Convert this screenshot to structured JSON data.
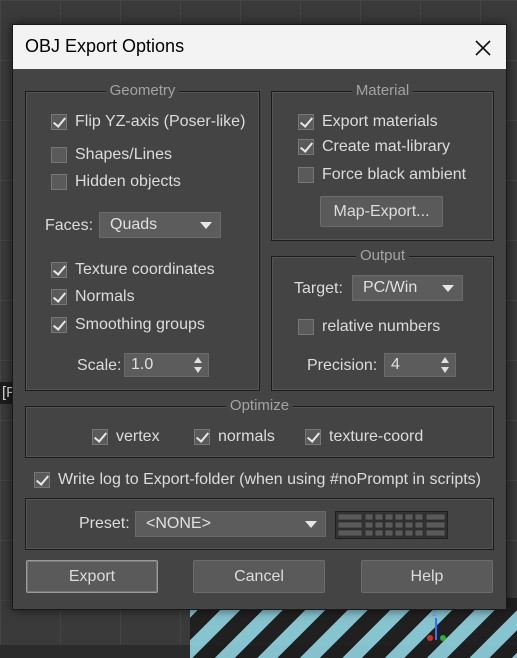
{
  "dialog": {
    "title": "OBJ Export Options"
  },
  "viewport": {
    "left_label": "[F"
  },
  "geometry": {
    "legend": "Geometry",
    "flip_yz": {
      "label": "Flip YZ-axis (Poser-like)",
      "checked": true
    },
    "shapes_lines": {
      "label": "Shapes/Lines",
      "checked": false
    },
    "hidden_objects": {
      "label": "Hidden objects",
      "checked": false
    },
    "faces_label": "Faces:",
    "faces_value": "Quads",
    "texture_coordinates": {
      "label": "Texture coordinates",
      "checked": true
    },
    "normals": {
      "label": "Normals",
      "checked": true
    },
    "smoothing_groups": {
      "label": "Smoothing groups",
      "checked": true
    },
    "scale_label": "Scale:",
    "scale_value": "1.0"
  },
  "material": {
    "legend": "Material",
    "export_materials": {
      "label": "Export materials",
      "checked": true
    },
    "create_mat_library": {
      "label": "Create mat-library",
      "checked": true
    },
    "force_black_ambient": {
      "label": "Force black ambient",
      "checked": false
    },
    "map_export_button": "Map-Export..."
  },
  "output": {
    "legend": "Output",
    "target_label": "Target:",
    "target_value": "PC/Win",
    "relative_numbers": {
      "label": "relative numbers",
      "checked": false
    },
    "precision_label": "Precision:",
    "precision_value": "4"
  },
  "optimize": {
    "legend": "Optimize",
    "vertex": {
      "label": "vertex",
      "checked": true
    },
    "normals": {
      "label": "normals",
      "checked": true
    },
    "texture_coord": {
      "label": "texture-coord",
      "checked": true
    }
  },
  "write_log": {
    "label": "Write log to Export-folder (when using #noPrompt in scripts)",
    "checked": true
  },
  "preset": {
    "label": "Preset:",
    "value": "<NONE>"
  },
  "buttons": {
    "export": "Export",
    "cancel": "Cancel",
    "help": "Help"
  },
  "colors": {
    "dialog_bg": "#444444",
    "titlebar_bg": "#f3f3f3",
    "text": "#dcdcdc",
    "legend_text": "#a3a3a3",
    "viewport_stripe": "#8fd3e0"
  },
  "icons": {
    "close": "close-icon",
    "check": "checkmark-icon",
    "dropdown": "chevron-down-icon",
    "spinner": "spinner-arrows-icon",
    "preset_grid": "preset-grid-icon",
    "axis_gizmo": "axis-gizmo-icon"
  }
}
